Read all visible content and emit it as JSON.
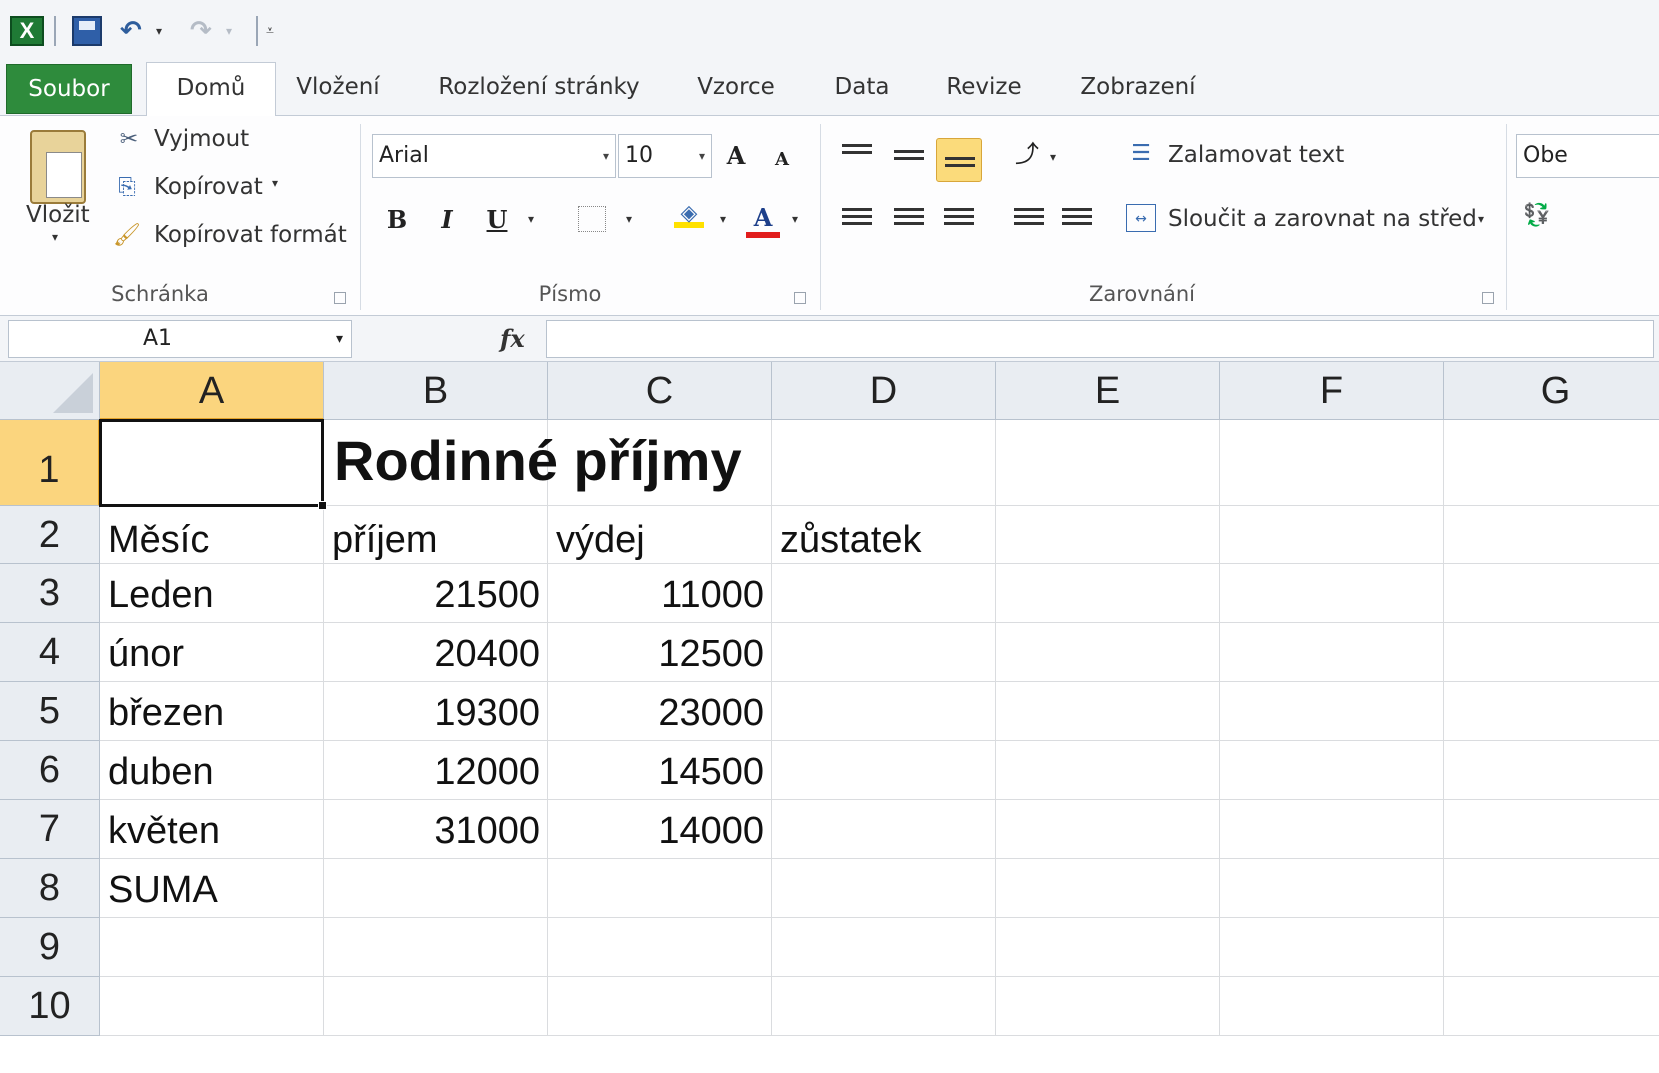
{
  "quick_access": {
    "app_icon": "excel-icon",
    "save_icon": "save-icon",
    "undo_icon": "undo-icon",
    "redo_icon": "redo-icon"
  },
  "tabs": [
    {
      "label": "Soubor"
    },
    {
      "label": "Domů"
    },
    {
      "label": "Vložení"
    },
    {
      "label": "Rozložení stránky"
    },
    {
      "label": "Vzorce"
    },
    {
      "label": "Data"
    },
    {
      "label": "Revize"
    },
    {
      "label": "Zobrazení"
    }
  ],
  "ribbon": {
    "clipboard": {
      "paste_label": "Vložit",
      "cut_label": "Vyjmout",
      "copy_label": "Kopírovat",
      "format_painter_label": "Kopírovat formát",
      "group_label": "Schránka"
    },
    "font": {
      "font_name": "Arial",
      "font_size": "10",
      "bold": "B",
      "italic": "I",
      "underline": "U",
      "font_color_glyph": "A",
      "grow_glyph": "A",
      "shrink_glyph": "A",
      "group_label": "Písmo"
    },
    "alignment": {
      "wrap_text_label": "Zalamovat text",
      "merge_label": "Sloučit a zarovnat na střed",
      "group_label": "Zarovnání"
    },
    "number": {
      "format_partial": "Obe"
    }
  },
  "formula_bar": {
    "name_box": "A1",
    "fx": "fx",
    "formula": ""
  },
  "sheet": {
    "columns": [
      "A",
      "B",
      "C",
      "D",
      "E",
      "F",
      "G"
    ],
    "rows": [
      "1",
      "2",
      "3",
      "4",
      "5",
      "6",
      "7",
      "8",
      "9",
      "10"
    ],
    "title": "Rodinné příjmy",
    "header": [
      "Měsíc",
      "příjem",
      "výdej",
      "zůstatek"
    ],
    "data": [
      [
        "Leden",
        "21500",
        "11000"
      ],
      [
        "únor",
        "20400",
        "12500"
      ],
      [
        "březen",
        "19300",
        "23000"
      ],
      [
        "duben",
        "12000",
        "14500"
      ],
      [
        "květen",
        "31000",
        "14000"
      ]
    ],
    "sum_label": "SUMA"
  },
  "colors": {
    "file_tab": "#2e8b3c",
    "selected_header": "#fbd57e",
    "header_bg": "#e9edf2"
  }
}
